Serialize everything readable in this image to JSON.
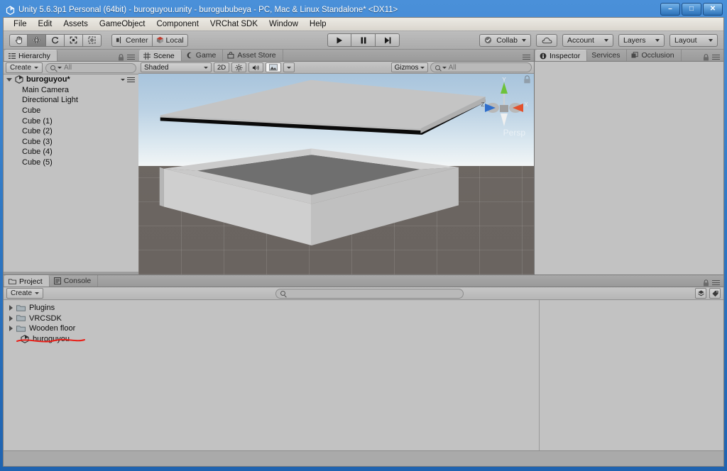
{
  "window": {
    "title": "Unity 5.6.3p1 Personal (64bit) - buroguyou.unity - burogububeya - PC, Mac & Linux Standalone* <DX11>",
    "minimize_label": "–",
    "maximize_label": "□",
    "close_label": "✕"
  },
  "menubar": {
    "items": [
      "File",
      "Edit",
      "Assets",
      "GameObject",
      "Component",
      "VRChat SDK",
      "Window",
      "Help"
    ]
  },
  "toolbar": {
    "tools": [
      {
        "name": "hand-tool",
        "glyph": "✋",
        "active": false
      },
      {
        "name": "move-tool",
        "glyph": "✥",
        "active": true
      },
      {
        "name": "rotate-tool",
        "glyph": "⟳",
        "active": false
      },
      {
        "name": "scale-tool",
        "glyph": "⤡",
        "active": false
      },
      {
        "name": "rect-tool",
        "glyph": "▣",
        "active": false
      }
    ],
    "pivot_mode": "Center",
    "pivot_rotation": "Local",
    "play_label": "▶",
    "pause_label": "❙❙",
    "step_label": "▶❘",
    "collab": "Collab",
    "cloud_icon": "cloud-icon",
    "account": "Account",
    "layers": "Layers",
    "layout": "Layout"
  },
  "hierarchy": {
    "tab": "Hierarchy",
    "create_label": "Create",
    "search_placeholder": "All",
    "search_value": "",
    "scene_name": "buroguyou*",
    "objects": [
      "Main Camera",
      "Directional Light",
      "Cube",
      "Cube (1)",
      "Cube (2)",
      "Cube (3)",
      "Cube (4)",
      "Cube (5)"
    ]
  },
  "scene_dock": {
    "tabs": [
      {
        "label": "Scene",
        "icon": "grid-icon",
        "active": true
      },
      {
        "label": "Game",
        "icon": "gamepad-icon",
        "active": false
      },
      {
        "label": "Asset Store",
        "icon": "store-icon",
        "active": false
      }
    ],
    "draw_mode": "Shaded",
    "mode_2d": "2D",
    "lighting_icon": "sun-icon",
    "audio_icon": "speaker-icon",
    "effects_icon": "image-icon",
    "gizmos_label": "Gizmos",
    "search_placeholder": "All",
    "search_value": "",
    "viewport": {
      "projection_label": "Persp",
      "axis_x": "X",
      "axis_y": "Y",
      "axis_z": "Z",
      "sky_top_color": "#a8c4dc",
      "sky_horizon_color": "#f0f5f7",
      "ground_color": "#6b6561",
      "slab_light_color": "#c8c8c8",
      "slab_mid_color": "#b4b4b4",
      "slab_dark_color": "#8e8e8e",
      "slab_black_color": "#090909"
    }
  },
  "inspector": {
    "tabs": [
      {
        "label": "Inspector",
        "icon": "info-icon",
        "active": true
      },
      {
        "label": "Services",
        "icon": "",
        "active": false
      },
      {
        "label": "Occlusion",
        "icon": "occlusion-icon",
        "active": false
      }
    ]
  },
  "project": {
    "tabs": [
      {
        "label": "Project",
        "icon": "folder-icon",
        "active": true
      },
      {
        "label": "Console",
        "icon": "console-icon",
        "active": false
      }
    ],
    "create_label": "Create",
    "search_placeholder": "",
    "search_value": "",
    "filter_type_icon": "filter-type-icon",
    "filter_label_icon": "filter-label-icon",
    "items": [
      {
        "label": "Plugins",
        "type": "folder",
        "expandable": true
      },
      {
        "label": "VRCSDK",
        "type": "folder",
        "expandable": true
      },
      {
        "label": "Wooden floor",
        "type": "folder",
        "expandable": true
      },
      {
        "label": "buroguyou",
        "type": "scene",
        "expandable": false
      }
    ],
    "annotation": {
      "name": "red-underline-annotation",
      "color": "#e8211a"
    }
  },
  "statusbar": {
    "text": ""
  }
}
